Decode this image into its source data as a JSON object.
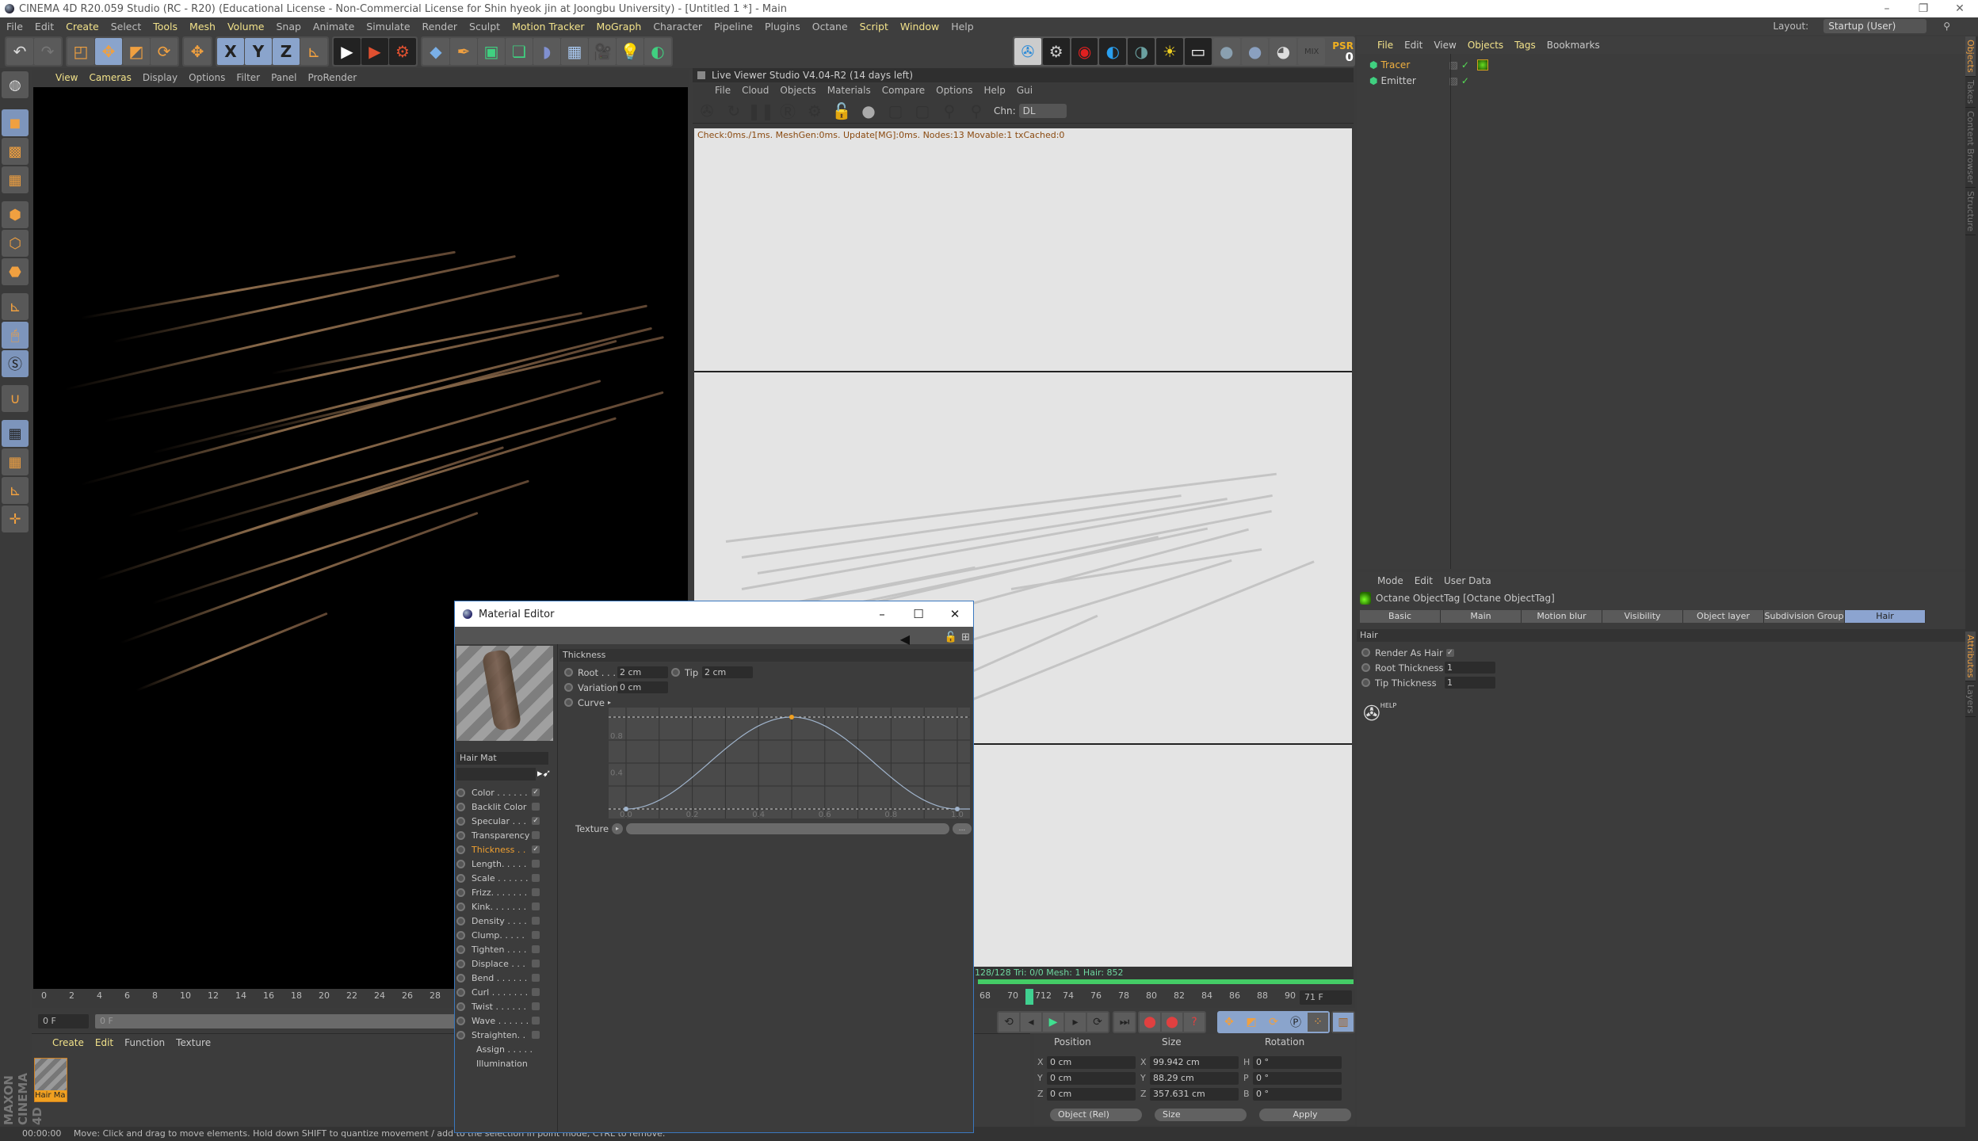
{
  "window": {
    "title": "CINEMA 4D R20.059 Studio (RC - R20) (Educational License - Non-Commercial License for Shin hyeok jin at Joongbu University) - [Untitled 1 *] - Main",
    "controls": [
      "–",
      "❐",
      "✕"
    ]
  },
  "menubar": {
    "items": [
      {
        "label": "File",
        "hl": false
      },
      {
        "label": "Edit",
        "hl": false
      },
      {
        "label": "Create",
        "hl": true
      },
      {
        "label": "Select",
        "hl": false
      },
      {
        "label": "Tools",
        "hl": true
      },
      {
        "label": "Mesh",
        "hl": true
      },
      {
        "label": "Volume",
        "hl": true
      },
      {
        "label": "Snap",
        "hl": false
      },
      {
        "label": "Animate",
        "hl": false
      },
      {
        "label": "Simulate",
        "hl": false
      },
      {
        "label": "Render",
        "hl": false
      },
      {
        "label": "Sculpt",
        "hl": false
      },
      {
        "label": "Motion Tracker",
        "hl": true
      },
      {
        "label": "MoGraph",
        "hl": true
      },
      {
        "label": "Character",
        "hl": false
      },
      {
        "label": "Pipeline",
        "hl": false
      },
      {
        "label": "Plugins",
        "hl": false
      },
      {
        "label": "Octane",
        "hl": false
      },
      {
        "label": "Script",
        "hl": true
      },
      {
        "label": "Window",
        "hl": true
      },
      {
        "label": "Help",
        "hl": false
      }
    ],
    "layout_label": "Layout:",
    "layout_value": "Startup (User)"
  },
  "toolbar": {
    "undo": "↶",
    "redo": "↷",
    "axis_x": "X",
    "axis_y": "Y",
    "axis_z": "Z",
    "psr_label": "PSR",
    "psr_value": "0"
  },
  "viewport": {
    "menu": [
      {
        "label": "View",
        "hl": true
      },
      {
        "label": "Cameras",
        "hl": true
      },
      {
        "label": "Display",
        "hl": false
      },
      {
        "label": "Options",
        "hl": false
      },
      {
        "label": "Filter",
        "hl": false
      },
      {
        "label": "Panel",
        "hl": false
      },
      {
        "label": "ProRender",
        "hl": false
      }
    ]
  },
  "live_viewer": {
    "title": "Live Viewer Studio V4.04-R2 (14 days left)",
    "menu": [
      "File",
      "Cloud",
      "Objects",
      "Materials",
      "Compare",
      "Options",
      "Help",
      "Gui"
    ],
    "channel_label": "Chn:",
    "channel_value": "DL",
    "status": "Check:0ms./1ms. MeshGen:0ms. Update[MG]:0ms. Nodes:13 Movable:1 txCached:0",
    "footer": "128/128   Tri: 0/0   Mesh: 1   Hair: 852",
    "progress": 1.0
  },
  "timeline": {
    "left_ticks": [
      "0",
      "2",
      "4",
      "6",
      "8",
      "10",
      "12",
      "14",
      "16",
      "18",
      "20",
      "22",
      "24",
      "26",
      "28"
    ],
    "right_ticks": [
      "68",
      "70",
      "712",
      "74",
      "76",
      "78",
      "80",
      "82",
      "84",
      "86",
      "88",
      "90"
    ],
    "current_frame": "0 F",
    "slider_value": "0 F",
    "end_frame": "71 F"
  },
  "material_manager": {
    "menu": [
      {
        "label": "Create",
        "hl": true
      },
      {
        "label": "Edit",
        "hl": true
      },
      {
        "label": "Function",
        "hl": false
      },
      {
        "label": "Texture",
        "hl": false
      }
    ],
    "material_label": "Hair Ma"
  },
  "brand": "MAXON CINEMA 4D",
  "status_bar": {
    "time": "00:00:00",
    "message": "Move: Click and drag to move elements. Hold down SHIFT to quantize movement / add to the selection in point mode, CTRL to remove."
  },
  "coordinates": {
    "headers": [
      "Position",
      "Size",
      "Rotation"
    ],
    "position": [
      {
        "axis": "X",
        "value": "0 cm"
      },
      {
        "axis": "Y",
        "value": "0 cm"
      },
      {
        "axis": "Z",
        "value": "0 cm"
      }
    ],
    "size": [
      {
        "axis": "X",
        "value": "99.942 cm"
      },
      {
        "axis": "Y",
        "value": "88.29 cm"
      },
      {
        "axis": "Z",
        "value": "357.631 cm"
      }
    ],
    "rotation": [
      {
        "axis": "H",
        "value": "0 °"
      },
      {
        "axis": "P",
        "value": "0 °"
      },
      {
        "axis": "B",
        "value": "0 °"
      }
    ],
    "mode": "Object (Rel)",
    "size_mode": "Size",
    "apply": "Apply"
  },
  "object_manager": {
    "menu": [
      {
        "label": "File",
        "hl": true
      },
      {
        "label": "Edit",
        "hl": false
      },
      {
        "label": "View",
        "hl": false
      },
      {
        "label": "Objects",
        "hl": true
      },
      {
        "label": "Tags",
        "hl": true
      },
      {
        "label": "Bookmarks",
        "hl": false
      }
    ],
    "objects": [
      {
        "name": "Tracer",
        "selected": true
      },
      {
        "name": "Emitter",
        "selected": false
      }
    ]
  },
  "side_tabs": [
    {
      "label": "Objects",
      "active": true
    },
    {
      "label": "Takes",
      "active": false
    },
    {
      "label": "Content Browser",
      "active": false
    },
    {
      "label": "Structure",
      "active": false
    },
    {
      "label": "Attributes",
      "active": true
    },
    {
      "label": "Layers",
      "active": false
    }
  ],
  "attributes": {
    "menu": [
      "Mode",
      "Edit",
      "User Data"
    ],
    "object_title": "Octane ObjectTag [Octane ObjectTag]",
    "tabs": [
      {
        "label": "Basic",
        "active": false
      },
      {
        "label": "Main",
        "active": false
      },
      {
        "label": "Motion blur",
        "active": false
      },
      {
        "label": "Visibility",
        "active": false
      },
      {
        "label": "Object layer",
        "active": false
      },
      {
        "label": "Subdivision Group",
        "active": false
      },
      {
        "label": "Hair",
        "active": true
      }
    ],
    "section": "Hair",
    "render_as_hair_label": "Render As Hair",
    "render_as_hair": true,
    "root_thickness_label": "Root Thickness",
    "root_thickness": "1",
    "tip_thickness_label": "Tip Thickness",
    "tip_thickness": "1",
    "help_label": "HELP"
  },
  "material_editor": {
    "title": "Material Editor",
    "material_name": "Hair Mat",
    "channels": [
      {
        "label": "Color . . . . . .",
        "checked": true,
        "radio": true
      },
      {
        "label": "Backlit Color",
        "checked": false,
        "radio": true
      },
      {
        "label": "Specular . . .",
        "checked": true,
        "radio": true
      },
      {
        "label": "Transparency",
        "checked": false,
        "radio": true
      },
      {
        "label": "Thickness . .",
        "checked": true,
        "radio": true,
        "active": true
      },
      {
        "label": "Length. . . . .",
        "checked": false,
        "radio": true
      },
      {
        "label": "Scale . . . . . .",
        "checked": false,
        "radio": true
      },
      {
        "label": "Frizz. . . . . . .",
        "checked": false,
        "radio": true
      },
      {
        "label": "Kink. . . . . . .",
        "checked": false,
        "radio": true
      },
      {
        "label": "Density . . . .",
        "checked": false,
        "radio": true
      },
      {
        "label": "Clump. . . . .",
        "checked": false,
        "radio": true
      },
      {
        "label": "Tighten . . . .",
        "checked": false,
        "radio": true
      },
      {
        "label": "Displace . . .",
        "checked": false,
        "radio": true
      },
      {
        "label": "Bend . . . . . .",
        "checked": false,
        "radio": true
      },
      {
        "label": "Curl . . . . . . .",
        "checked": false,
        "radio": true
      },
      {
        "label": "Twist . . . . . .",
        "checked": false,
        "radio": true
      },
      {
        "label": "Wave . . . . . .",
        "checked": false,
        "radio": true
      },
      {
        "label": "Straighten. .",
        "checked": false,
        "radio": true
      },
      {
        "label": "Assign . . . . .",
        "checked": null,
        "radio": false
      },
      {
        "label": "Illumination",
        "checked": null,
        "radio": false
      }
    ],
    "section": "Thickness",
    "root_label": "Root . . .",
    "root_value": "2 cm",
    "tip_label": "Tip",
    "tip_value": "2 cm",
    "variation_label": "Variation",
    "variation_value": "0 cm",
    "curve_label": "Curve",
    "texture_label": "Texture",
    "texture_btn": "...",
    "curve": {
      "x_ticks": [
        "0.0",
        "0.2",
        "0.4",
        "0.6",
        "0.8",
        "1.0"
      ],
      "y_ticks": [
        "0.4",
        "0.8"
      ],
      "points": [
        [
          0,
          0
        ],
        [
          0.5,
          1
        ],
        [
          1,
          0
        ]
      ]
    }
  }
}
